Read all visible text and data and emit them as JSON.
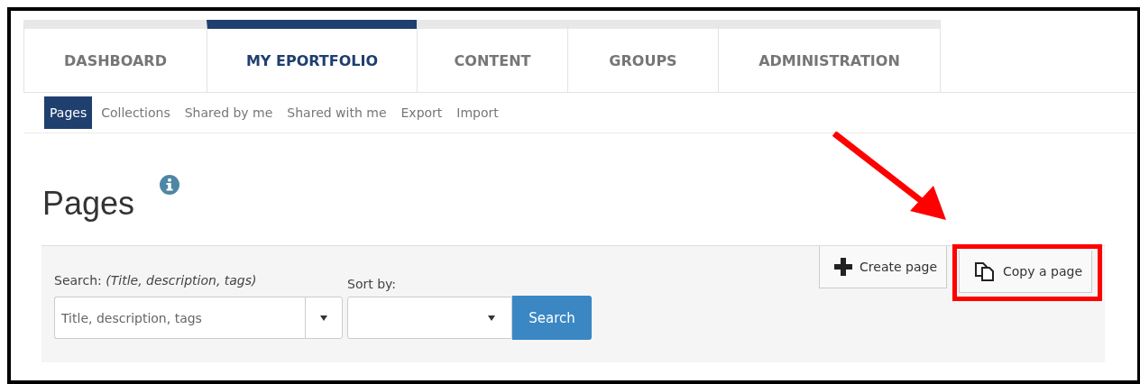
{
  "tabs": [
    {
      "label": "DASHBOARD",
      "selected": false
    },
    {
      "label": "MY EPORTFOLIO",
      "selected": true
    },
    {
      "label": "CONTENT",
      "selected": false
    },
    {
      "label": "GROUPS",
      "selected": false
    },
    {
      "label": "ADMINISTRATION",
      "selected": false
    }
  ],
  "subnav": [
    {
      "label": "Pages",
      "selected": true
    },
    {
      "label": "Collections",
      "selected": false
    },
    {
      "label": "Shared by me",
      "selected": false
    },
    {
      "label": "Shared with me",
      "selected": false
    },
    {
      "label": "Export",
      "selected": false
    },
    {
      "label": "Import",
      "selected": false
    }
  ],
  "page_title": "Pages",
  "search": {
    "label": "Search: *(Title, description, tags)*",
    "placeholder": "Title, description, tags"
  },
  "sort": {
    "label": "Sort by:"
  },
  "search_button": "Search",
  "actions": [
    {
      "label": "Create page",
      "kind": "create",
      "highlighted": false
    },
    {
      "label": "Copy a page",
      "kind": "copy",
      "highlighted": true
    }
  ]
}
